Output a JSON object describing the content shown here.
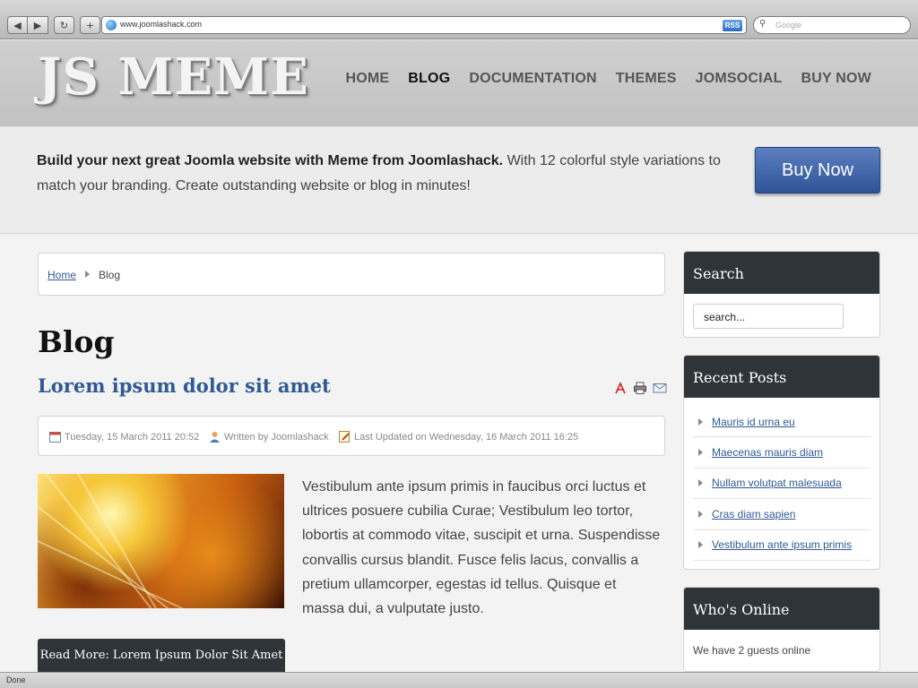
{
  "browser": {
    "back_glyph": "◀",
    "forward_glyph": "▶",
    "reload_glyph": "↻",
    "add_glyph": "+",
    "url": "www.joomlashack.com",
    "rss_label": "RSS",
    "search_placeholder": "Google",
    "status": "Done"
  },
  "header": {
    "logo": "JS MEME",
    "nav": [
      {
        "label": "HOME",
        "active": false
      },
      {
        "label": "BLOG",
        "active": true
      },
      {
        "label": "DOCUMENTATION",
        "active": false
      },
      {
        "label": "THEMES",
        "active": false
      },
      {
        "label": "JOMSOCIAL",
        "active": false
      },
      {
        "label": "BUY NOW",
        "active": false
      }
    ]
  },
  "intro": {
    "bold_text": "Build your next great Joomla website with Meme from Joomlashack.",
    "text": " With 12 colorful style variations to match your branding. Create outstanding website or blog in minutes!",
    "buy_label": "Buy Now"
  },
  "breadcrumb": {
    "home": "Home",
    "current": "Blog"
  },
  "main": {
    "page_title": "Blog",
    "article": {
      "title": "Lorem ipsum dolor sit amet",
      "date": "Tuesday, 15 March 2011 20:52",
      "author": "Written by Joomlashack",
      "updated": "Last Updated on Wednesday, 16 March 2011 16:25",
      "body": "Vestibulum ante ipsum primis in faucibus orci luctus et ultrices posuere cubilia Curae; Vestibulum leo tortor, lobortis at commodo vitae, suscipit et urna. Suspendisse convallis cursus blandit. Fusce felis lacus, convallis a pretium ullamcorper, egestas id tellus. Quisque et massa dui, a vulputate justo.",
      "read_more": "Read More: Lorem Ipsum Dolor Sit Amet"
    }
  },
  "sidebar": {
    "search": {
      "title": "Search",
      "value": "search..."
    },
    "recent": {
      "title": "Recent Posts",
      "items": [
        "Mauris id urna eu",
        "Maecenas mauris diam",
        "Nullam volutpat malesuada",
        "Cras diam sapien",
        "Vestibulum ante ipsum primis"
      ]
    },
    "online": {
      "title": "Who's Online",
      "text": "We have 2 guests online"
    }
  },
  "colors": {
    "link": "#2f5a94",
    "buy_button": "#3f65a8",
    "module_header": "#2f3438"
  }
}
